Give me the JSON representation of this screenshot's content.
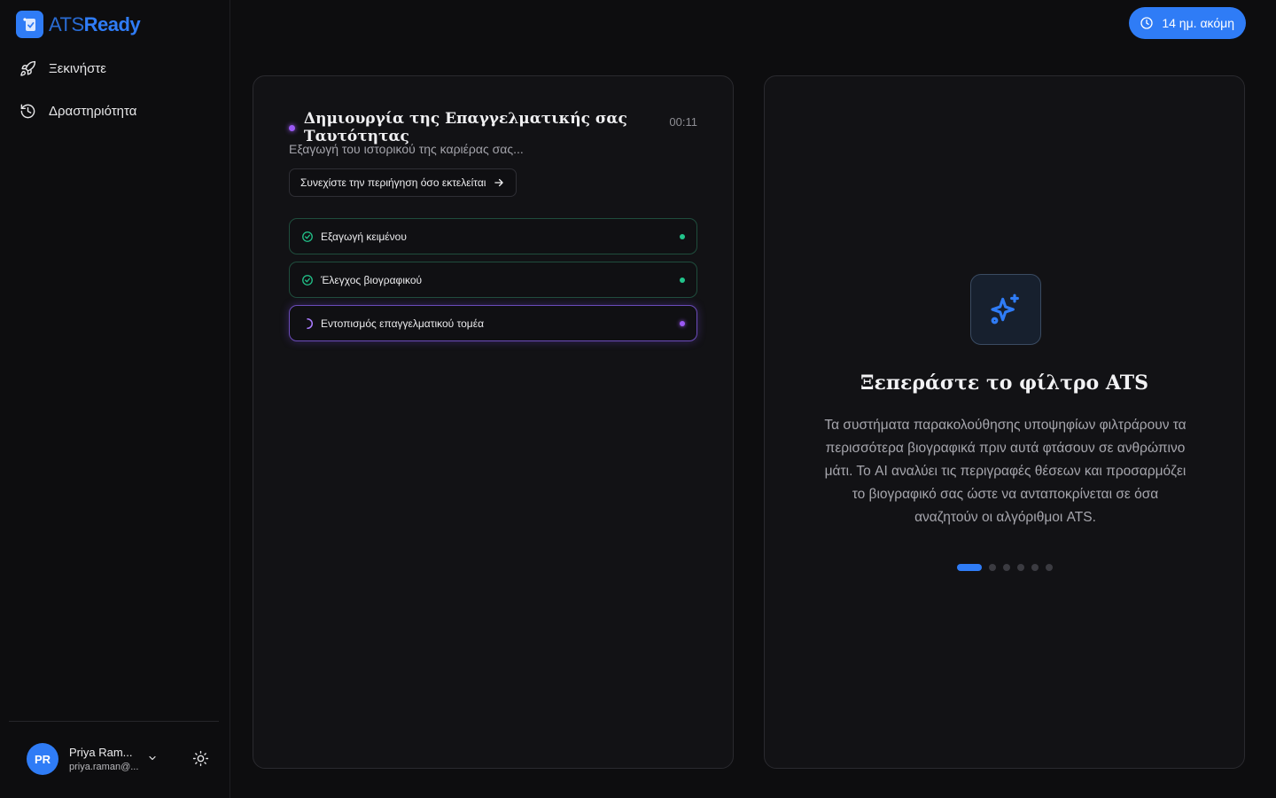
{
  "brand": {
    "part1": "ATS",
    "part2": "Ready"
  },
  "sidebar": {
    "items": [
      {
        "label": "Ξεκινήστε",
        "icon": "rocket-icon"
      },
      {
        "label": "Δραστηριότητα",
        "icon": "history-icon"
      }
    ]
  },
  "user": {
    "initials": "PR",
    "name": "Priya Ram...",
    "email": "priya.raman@..."
  },
  "trial": {
    "label": "14 ημ. ακόμη"
  },
  "task": {
    "title": "Δημιουργία της Επαγγελματικής σας Ταυτότητας",
    "timer": "00:11",
    "subtitle": "Εξαγωγή του ιστορικού της καριέρας σας...",
    "continue_label": "Συνεχίστε την περιήγηση όσο εκτελείται",
    "steps": [
      {
        "label": "Εξαγωγή κειμένου",
        "status": "done"
      },
      {
        "label": "Έλεγχος βιογραφικού",
        "status": "done"
      },
      {
        "label": "Εντοπισμός επαγγελματικού τομέα",
        "status": "in-progress"
      }
    ]
  },
  "feature": {
    "icon": "sparkles-icon",
    "title": "Ξεπεράστε το φίλτρο ATS",
    "description": "Τα συστήματα παρακολούθησης υποψηφίων φιλτράρουν τα περισσότερα βιογραφικά πριν αυτά φτάσουν σε ανθρώπινο μάτι. Το AI αναλύει τις περιγραφές θέσεων και προσαρμόζει το βιογραφικό σας ώστε να ανταποκρίνεται σε όσα αναζητούν οι αλγόριθμοι ATS.",
    "pager": {
      "total": 6,
      "active": 1
    }
  },
  "colors": {
    "accent": "#2f7cf6",
    "success": "#22c48b",
    "progress": "#9b59f5",
    "background": "#0d0d0f"
  }
}
